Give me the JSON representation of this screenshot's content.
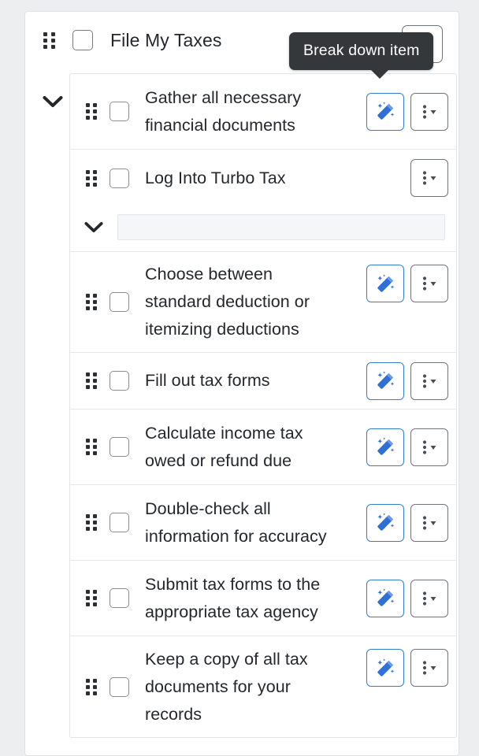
{
  "tooltip": {
    "text": "Break down item",
    "target": "break-down-item-button"
  },
  "root_task": {
    "title": "File My Taxes",
    "checked": false,
    "drag_handle_icon": "drag-handle-icon",
    "checkbox_icon": "checkbox-unchecked-icon",
    "expand_icon": "chevron-down-icon",
    "expanded": true
  },
  "colors": {
    "page_background": "#eceef0",
    "card_background": "#ffffff",
    "card_border": "#dfe1e5",
    "row_divider": "#e6e8ea",
    "text_primary": "#24282c",
    "accent_blue": "#2f7fd0",
    "wand_blue": "#2f6fd8",
    "tooltip_background": "#35383b",
    "tooltip_text": "#ffffff",
    "menu_button_border": "#6f7479",
    "checkbox_border": "#76797d",
    "skeleton_fill": "#f5f6f8"
  },
  "icons": {
    "drag_handle": "drag-handle-icon",
    "checkbox": "checkbox-unchecked-icon",
    "wand": "magic-wand-icon",
    "menu": "kebab-menu-dropdown-icon",
    "chevron": "chevron-down-icon"
  },
  "buttons": {
    "wand_label": "Break down item",
    "menu_label": "More options"
  },
  "subtasks": [
    {
      "title": "Gather all necessary financial documents",
      "checked": false,
      "has_wand": true,
      "has_menu": true,
      "lines": 2
    },
    {
      "title": "Log Into Turbo Tax",
      "checked": false,
      "has_wand": false,
      "has_menu": true,
      "lines": 1,
      "nested": {
        "expand_icon": "chevron-down-icon",
        "placeholder_bar": ""
      }
    },
    {
      "title": "Choose between standard deduction or itemizing deductions",
      "checked": false,
      "has_wand": true,
      "has_menu": true,
      "lines": 3
    },
    {
      "title": "Fill out tax forms",
      "checked": false,
      "has_wand": true,
      "has_menu": true,
      "lines": 1
    },
    {
      "title": "Calculate income tax owed or refund due",
      "checked": false,
      "has_wand": true,
      "has_menu": true,
      "lines": 2
    },
    {
      "title": "Double-check all information for accuracy",
      "checked": false,
      "has_wand": true,
      "has_menu": true,
      "lines": 2
    },
    {
      "title": "Submit tax forms to the appropriate tax agency",
      "checked": false,
      "has_wand": true,
      "has_menu": true,
      "lines": 2
    },
    {
      "title": "Keep a copy of all tax documents for your records",
      "checked": false,
      "has_wand": true,
      "has_menu": true,
      "lines": 3
    }
  ]
}
